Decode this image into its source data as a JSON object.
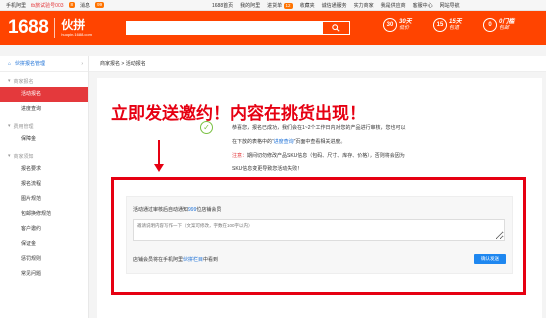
{
  "topbar": {
    "mobile": "手机阿里",
    "user": "tb旅试验号003",
    "user_badge": "8",
    "messages": "消息",
    "messages_badge": "99",
    "links": [
      "1688首页",
      "我的阿里",
      "进货单",
      "收藏夹",
      "诚信通服务",
      "实力商家",
      "我是供应商",
      "客服中心",
      "网站导航"
    ],
    "cart_badge": "12"
  },
  "header": {
    "logo_number": "1688",
    "logo_name": "伙拼",
    "logo_url": "huopin.1688.com",
    "promos": [
      {
        "icon": "30",
        "title": "30天",
        "sub": "低价"
      },
      {
        "icon": "15",
        "title": "15天",
        "sub": "包退"
      },
      {
        "icon": "0",
        "title": "0门槛",
        "sub": "包邮"
      }
    ]
  },
  "sidebar": {
    "title": "伙拼报名管理",
    "groups": [
      {
        "name": "商家报名",
        "items": [
          "活动报名",
          "进度查询"
        ]
      },
      {
        "name": "费用管理",
        "items": [
          "保障金"
        ]
      },
      {
        "name": "商家须知",
        "items": [
          "报名要求",
          "报名流程",
          "图片规范",
          "包邮换修规范",
          "客户邀约",
          "保证金",
          "惩罚规则",
          "常见问题"
        ]
      }
    ],
    "active": "活动报名"
  },
  "breadcrumb": "商家报名 > 活动报名",
  "annotation": {
    "headline": "立即发送邀约！内容在挑货出现！"
  },
  "message": {
    "line1": "恭喜您，报名已成功，我们会在1~2个工作日内对您的产品进行审核，您也可以",
    "line2_pre": "在下放的表格中的“",
    "line2_link": "进度查询",
    "line2_post": "”页面中查看相关进度。",
    "line3_label": "注意：",
    "line3": "期间切勿修改产品SKU信息（包码、尺寸、库存、价格），否则将会因为",
    "line4": "SKU信息变更导致您活动失败！"
  },
  "invite": {
    "label_pre": "活动通过审核后自动通知",
    "label_count": "999",
    "label_post": "位店铺会员",
    "placeholder": "邀请说明内容写作一下（文案可修改，字数在100字以内）",
    "foot_pre": "店铺会员将在手机阿里",
    "foot_link": "伙拼栏目",
    "foot_post": "中看到",
    "submit": "确认发送"
  }
}
